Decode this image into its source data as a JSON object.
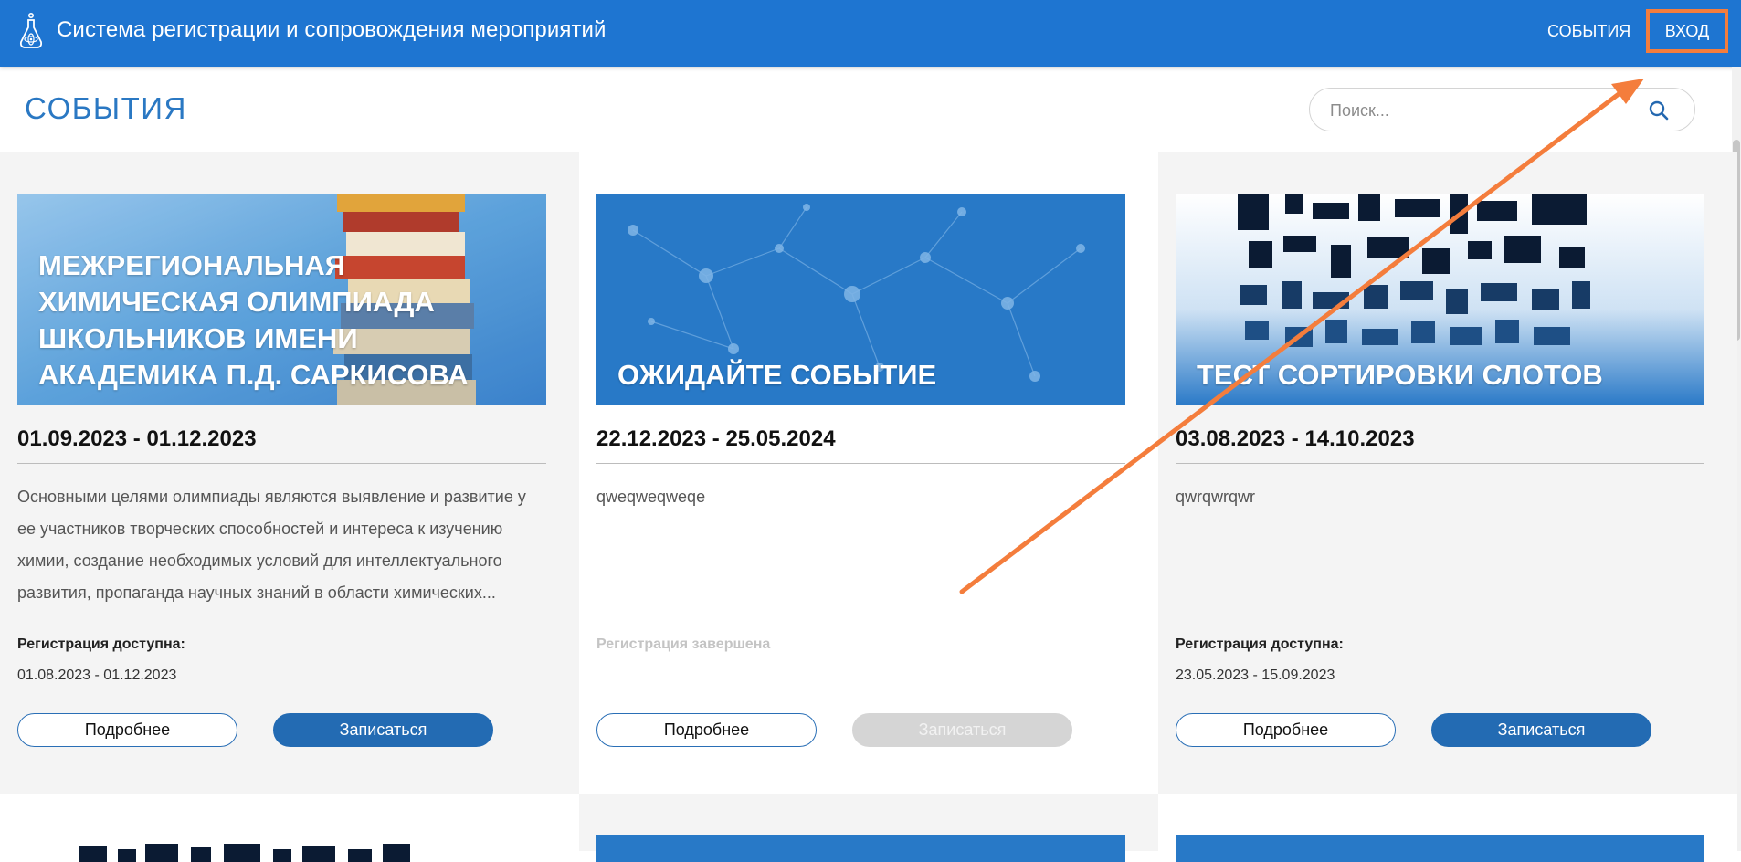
{
  "header": {
    "app_title": "Система регистрации и сопровождения мероприятий",
    "nav_events": "СОБЫТИЯ",
    "nav_login": "ВХОД",
    "logo_icon": "atom-flask-logo-icon",
    "bar_color": "#1e75d1",
    "highlight_color": "#f47d3c"
  },
  "page": {
    "title": "СОБЫТИЯ"
  },
  "search": {
    "placeholder": "Поиск...",
    "value": "",
    "icon": "search-icon"
  },
  "events": [
    {
      "banner_title": "Межрегиональная химическая олимпиада школьников имени академика П.Д. Саркисова",
      "banner_style": "books-on-blue",
      "dates": "01.09.2023 - 01.12.2023",
      "description": "Основными целями олимпиады являются выявление и развитие у ее участников творческих способностей и интереса к изучению химии, создание необходимых условий для интеллектуального развития, пропаганда научных знаний в области химических...",
      "registration_label": "Регистрация доступна:",
      "registration_dates": "01.08.2023 - 01.12.2023",
      "details_label": "Подробнее",
      "signup_label": "Записаться",
      "signup_enabled": true
    },
    {
      "banner_title": "Ожидайте событие",
      "banner_style": "molecule-network",
      "dates": "22.12.2023 - 25.05.2024",
      "description": "qweqweqweqe",
      "registration_label": "Регистрация завершена",
      "registration_dates": "",
      "details_label": "Подробнее",
      "signup_label": "Записаться",
      "signup_enabled": false
    },
    {
      "banner_title": "Тест сортировки слотов",
      "banner_style": "qr-pattern",
      "dates": "03.08.2023 - 14.10.2023",
      "description": "qwrqwrqwr",
      "registration_label": "Регистрация доступна:",
      "registration_dates": "23.05.2023 - 15.09.2023",
      "details_label": "Подробнее",
      "signup_label": "Записаться",
      "signup_enabled": true
    }
  ],
  "colors": {
    "accent": "#2a78c3",
    "button_fill": "#236bb3",
    "button_disabled": "#d5d5d5",
    "card_gray": "#f4f4f4"
  }
}
